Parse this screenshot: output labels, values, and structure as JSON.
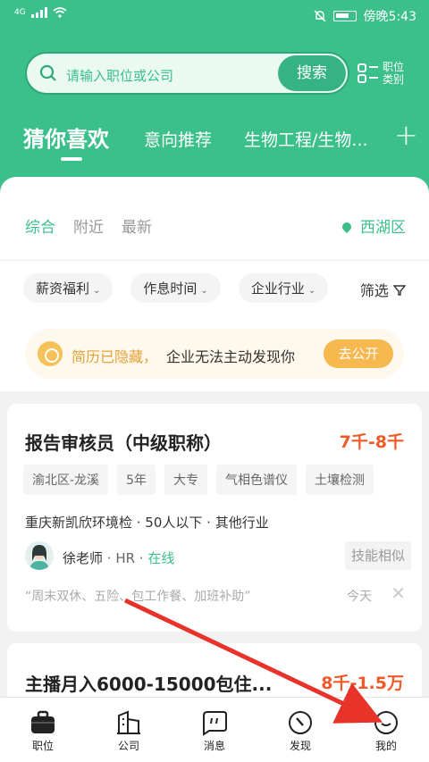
{
  "status": {
    "network": "4G",
    "time": "傍晚5:43",
    "icons": [
      "signal-icon",
      "wifi-icon",
      "mute-icon",
      "battery-icon"
    ]
  },
  "search": {
    "placeholder": "请输入职位或公司",
    "button": "搜索",
    "category_label": "职位类别"
  },
  "tabs": {
    "active": "猜你喜欢",
    "items": [
      "意向推荐",
      "生物工程/生物..."
    ],
    "add": "+"
  },
  "sub_tabs": {
    "items": [
      "综合",
      "附近",
      "最新"
    ],
    "location": "西湖区"
  },
  "filters": {
    "chips": [
      "薪资福利",
      "作息时间",
      "企业行业"
    ],
    "more": "筛选"
  },
  "notice": {
    "highlight": "简历已隐藏，",
    "text": "企业无法主动发现你",
    "button": "去公开"
  },
  "job1": {
    "title": "报告审核员（中级职称）",
    "salary": "7千-8千",
    "tags": [
      "渝北区-龙溪",
      "5年",
      "大专",
      "气相色谱仪",
      "土壤检测"
    ],
    "company": "重庆新凯欣环境检 · 50人以下 · 其他行业",
    "hr_name": "徐老师",
    "hr_role": " · HR · ",
    "hr_status": "在线",
    "skill_badge": "技能相似",
    "quote": "“周末双休、五险、包工作餐、加班补助”",
    "date": "今天",
    "close": "✕"
  },
  "job2": {
    "title": "主播月入6000-15000包住...",
    "salary": "8千-1.5万"
  },
  "nav": {
    "items": [
      {
        "label": "职位",
        "icon": "briefcase-icon"
      },
      {
        "label": "公司",
        "icon": "building-icon"
      },
      {
        "label": "消息",
        "icon": "message-icon"
      },
      {
        "label": "发现",
        "icon": "discover-icon"
      },
      {
        "label": "我的",
        "icon": "profile-icon"
      }
    ]
  },
  "colors": {
    "brand": "#3bbf8b",
    "salary": "#f05a28",
    "notice": "#f7b850",
    "annotation_arrow": "#e8332a"
  }
}
